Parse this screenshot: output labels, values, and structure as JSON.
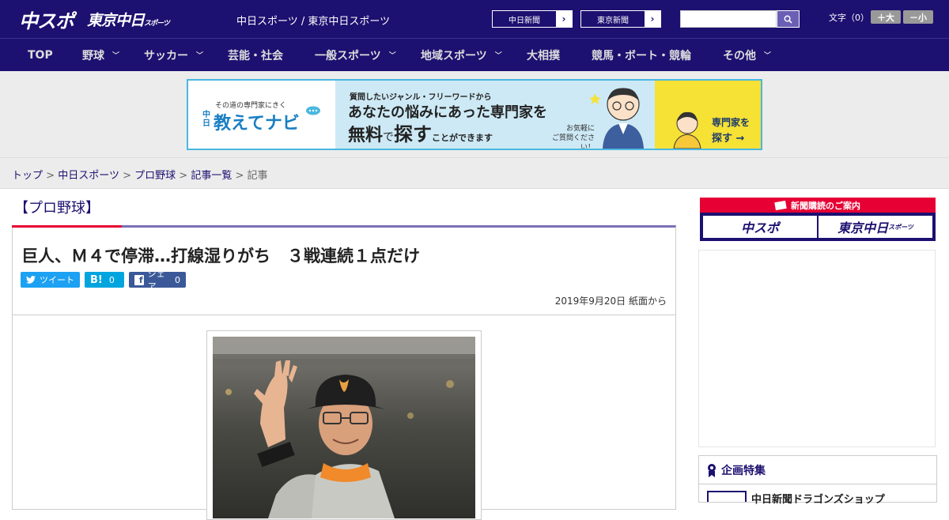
{
  "header": {
    "logo_chuspo": "中スポ",
    "logo_tokyo": "東京中日",
    "logo_tokyo_small": "スポーツ",
    "tagline": "中日スポーツ / 東京中日スポーツ",
    "paper_links": [
      "中日新聞",
      "東京新聞"
    ],
    "fontsize_label": "文字（0）",
    "fontsize_plus": "＋大",
    "fontsize_minus": "－小"
  },
  "nav": {
    "items": [
      {
        "label": "TOP",
        "has_menu": false
      },
      {
        "label": "野球",
        "has_menu": true
      },
      {
        "label": "サッカー",
        "has_menu": true
      },
      {
        "label": "芸能・社会",
        "has_menu": false
      },
      {
        "label": "一般スポーツ",
        "has_menu": true
      },
      {
        "label": "地域スポーツ",
        "has_menu": true
      },
      {
        "label": "大相撲",
        "has_menu": false
      },
      {
        "label": "競馬・ボート・競輪",
        "has_menu": false
      },
      {
        "label": "その他",
        "has_menu": true
      }
    ]
  },
  "banner": {
    "brand_small": "その道の専門家にきく",
    "brand_prefix": "中日",
    "brand_name": "教えてナビ",
    "line1": "質問したいジャンル・フリーワードから",
    "line2": "あなたの悩みにあった専門家を",
    "line3a": "無料",
    "line3b": "で",
    "line3c": "探す",
    "line3d": "ことができます",
    "note1": "お気軽に",
    "note2": "ご質問ください！",
    "cta1": "専門家を",
    "cta2": "探す",
    "colors": {
      "border": "#4ab7e0",
      "mid_bg": "#cde9f5",
      "cta_bg": "#f6e135"
    }
  },
  "breadcrumb": {
    "items": [
      "トップ",
      "中日スポーツ",
      "プロ野球",
      "記事一覧"
    ],
    "current": "記事",
    "sep": ">"
  },
  "article": {
    "category": "【プロ野球】",
    "title": "巨人、Ｍ４で停滞…打線湿りがち　３戦連続１点だけ",
    "share": {
      "tweet": "ツイート",
      "hatena": "B!",
      "hatena_count": "0",
      "facebook": "シェア",
      "facebook_count": "0"
    },
    "date": "2019年9月20日 紙面から"
  },
  "sidebar": {
    "guide_title": "新聞購読のご案内",
    "guide_btn_1": "中スポ",
    "guide_btn_2": "東京中日",
    "guide_btn_2_small": "スポーツ",
    "feature_title": "企画特集",
    "feature_item": "中日新聞ドラゴンズショップ"
  },
  "colors": {
    "brand": "#1c1070",
    "accent_red": "#e60033",
    "twitter": "#1da1f2",
    "hatena": "#00a4de",
    "facebook": "#3b5998"
  }
}
